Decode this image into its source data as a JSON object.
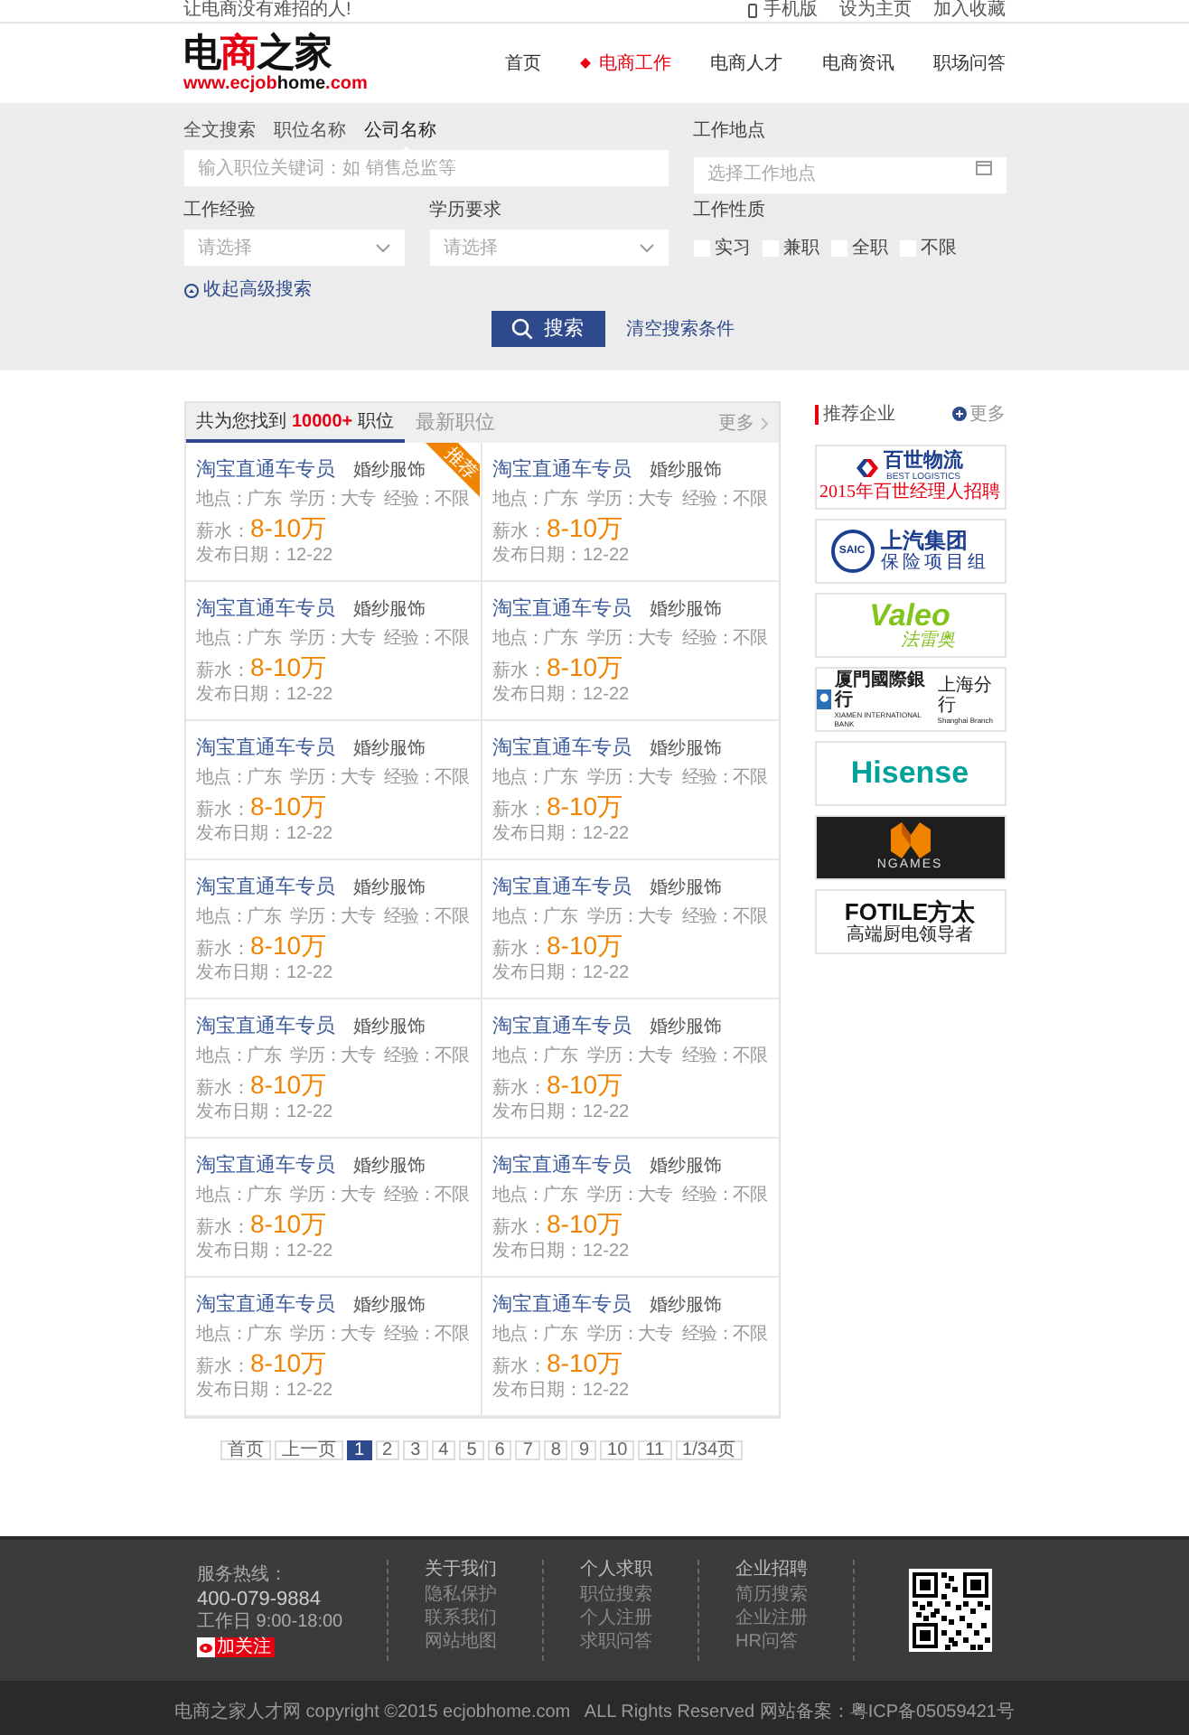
{
  "top_bar": {
    "slogan": "让电商没有难招的人!",
    "links": [
      "手机版",
      "设为主页",
      "加入收藏"
    ]
  },
  "logo": {
    "title_parts": [
      {
        "text": "电",
        "color": "#111111"
      },
      {
        "text": "商",
        "color": "#e60012"
      },
      {
        "text": "之家",
        "color": "#111111"
      }
    ],
    "url_parts": [
      {
        "text": "www.ecjob",
        "color": "#e60012"
      },
      {
        "text": "home",
        "color": "#111111"
      },
      {
        "text": ".com",
        "color": "#e60012"
      }
    ]
  },
  "nav": [
    {
      "label": "首页",
      "selected": false
    },
    {
      "label": "电商工作",
      "selected": true
    },
    {
      "label": "电商人才",
      "selected": false
    },
    {
      "label": "电商资讯",
      "selected": false
    },
    {
      "label": "职场问答",
      "selected": false
    }
  ],
  "search": {
    "tabs": [
      {
        "label": "全文搜索",
        "selected": false
      },
      {
        "label": "职位名称",
        "selected": false
      },
      {
        "label": "公司名称",
        "selected": true
      }
    ],
    "keyword_placeholder": "输入职位关键词：如 销售总监等",
    "location_label": "工作地点",
    "location_placeholder": "选择工作地点",
    "experience_label": "工作经验",
    "experience_placeholder": "请选择",
    "education_label": "学历要求",
    "education_placeholder": "请选择",
    "type_label": "工作性质",
    "types": [
      {
        "label": "实习",
        "checked": false
      },
      {
        "label": "兼职",
        "checked": false
      },
      {
        "label": "全职",
        "checked": false
      },
      {
        "label": "不限",
        "checked": false
      }
    ],
    "collapse_link": "收起高级搜索",
    "search_button": "搜索",
    "clear_link": "清空搜索条件"
  },
  "list_tabs": [
    {
      "label": "共为您找到**10000+**职位",
      "selected": true
    },
    {
      "label": "最新职位",
      "selected": false
    }
  ],
  "more_link": "更多",
  "jobs": [
    {
      "title": "淘宝直通车专员",
      "company": "婚纱服饰",
      "location": "地点：广东",
      "education": "学历：大专",
      "experience": "经验：不限",
      "salary_label": "薪水：",
      "salary": "8-10万",
      "date": "发布日期：12-22",
      "featured": true,
      "badge": "推荐"
    },
    {
      "title": "淘宝直通车专员",
      "company": "婚纱服饰",
      "location": "地点：广东",
      "education": "学历：大专",
      "experience": "经验：不限",
      "salary_label": "薪水：",
      "salary": "8-10万",
      "date": "发布日期：12-22",
      "featured": false
    },
    {
      "title": "淘宝直通车专员",
      "company": "婚纱服饰",
      "location": "地点：广东",
      "education": "学历：大专",
      "experience": "经验：不限",
      "salary_label": "薪水：",
      "salary": "8-10万",
      "date": "发布日期：12-22",
      "featured": false
    },
    {
      "title": "淘宝直通车专员",
      "company": "婚纱服饰",
      "location": "地点：广东",
      "education": "学历：大专",
      "experience": "经验：不限",
      "salary_label": "薪水：",
      "salary": "8-10万",
      "date": "发布日期：12-22",
      "featured": false
    },
    {
      "title": "淘宝直通车专员",
      "company": "婚纱服饰",
      "location": "地点：广东",
      "education": "学历：大专",
      "experience": "经验：不限",
      "salary_label": "薪水：",
      "salary": "8-10万",
      "date": "发布日期：12-22",
      "featured": false
    },
    {
      "title": "淘宝直通车专员",
      "company": "婚纱服饰",
      "location": "地点：广东",
      "education": "学历：大专",
      "experience": "经验：不限",
      "salary_label": "薪水：",
      "salary": "8-10万",
      "date": "发布日期：12-22",
      "featured": false
    },
    {
      "title": "淘宝直通车专员",
      "company": "婚纱服饰",
      "location": "地点：广东",
      "education": "学历：大专",
      "experience": "经验：不限",
      "salary_label": "薪水：",
      "salary": "8-10万",
      "date": "发布日期：12-22",
      "featured": false
    },
    {
      "title": "淘宝直通车专员",
      "company": "婚纱服饰",
      "location": "地点：广东",
      "education": "学历：大专",
      "experience": "经验：不限",
      "salary_label": "薪水：",
      "salary": "8-10万",
      "date": "发布日期：12-22",
      "featured": false
    },
    {
      "title": "淘宝直通车专员",
      "company": "婚纱服饰",
      "location": "地点：广东",
      "education": "学历：大专",
      "experience": "经验：不限",
      "salary_label": "薪水：",
      "salary": "8-10万",
      "date": "发布日期：12-22",
      "featured": false
    },
    {
      "title": "淘宝直通车专员",
      "company": "婚纱服饰",
      "location": "地点：广东",
      "education": "学历：大专",
      "experience": "经验：不限",
      "salary_label": "薪水：",
      "salary": "8-10万",
      "date": "发布日期：12-22",
      "featured": false
    },
    {
      "title": "淘宝直通车专员",
      "company": "婚纱服饰",
      "location": "地点：广东",
      "education": "学历：大专",
      "experience": "经验：不限",
      "salary_label": "薪水：",
      "salary": "8-10万",
      "date": "发布日期：12-22",
      "featured": false
    },
    {
      "title": "淘宝直通车专员",
      "company": "婚纱服饰",
      "location": "地点：广东",
      "education": "学历：大专",
      "experience": "经验：不限",
      "salary_label": "薪水：",
      "salary": "8-10万",
      "date": "发布日期：12-22",
      "featured": false
    },
    {
      "title": "淘宝直通车专员",
      "company": "婚纱服饰",
      "location": "地点：广东",
      "education": "学历：大专",
      "experience": "经验：不限",
      "salary_label": "薪水：",
      "salary": "8-10万",
      "date": "发布日期：12-22",
      "featured": false
    },
    {
      "title": "淘宝直通车专员",
      "company": "婚纱服饰",
      "location": "地点：广东",
      "education": "学历：大专",
      "experience": "经验：不限",
      "salary_label": "薪水：",
      "salary": "8-10万",
      "date": "发布日期：12-22",
      "featured": false
    }
  ],
  "pagination": {
    "first": "首页",
    "prev": "上一页",
    "pages": [
      {
        "label": "1",
        "selected": true
      },
      {
        "label": "2",
        "selected": false
      },
      {
        "label": "3",
        "selected": false
      },
      {
        "label": "4",
        "selected": false
      },
      {
        "label": "5",
        "selected": false
      },
      {
        "label": "6",
        "selected": false
      },
      {
        "label": "7",
        "selected": false
      },
      {
        "label": "8",
        "selected": false
      },
      {
        "label": "9",
        "selected": false
      },
      {
        "label": "10",
        "selected": false
      },
      {
        "label": "11",
        "selected": false
      }
    ],
    "total": "1/34页"
  },
  "sidebar": {
    "title": "推荐企业",
    "more": "更多",
    "companies": [
      {
        "kind": "best",
        "texts": [
          "百世物流",
          "BEST LOGISTICS",
          "2015年百世经理人招聘"
        ]
      },
      {
        "kind": "saic",
        "texts": [
          "SAIC",
          "上汽集团",
          "保险项目组"
        ]
      },
      {
        "kind": "valeo",
        "texts": [
          "Valeo",
          "法雷奥"
        ]
      },
      {
        "kind": "bank",
        "texts": [
          "厦門國際銀行",
          "XIAMEN INTERNATIONAL BANK",
          "上海分行",
          "Shanghai Branch"
        ]
      },
      {
        "kind": "hisense",
        "texts": [
          "Hisense"
        ]
      },
      {
        "kind": "ngames",
        "texts": [
          "NGAMES"
        ]
      },
      {
        "kind": "fotile",
        "texts": [
          "FOTILE方太",
          "高端厨电领导者"
        ]
      }
    ]
  },
  "footer": {
    "hotline_label": "服务热线：",
    "hotline": "400-079-9884",
    "hours": "工作日 9:00-18:00",
    "follow_button": "加关注",
    "columns": [
      {
        "title": "关于我们",
        "links": [
          "隐私保护",
          "联系我们",
          "网站地图"
        ]
      },
      {
        "title": "个人求职",
        "links": [
          "职位搜索",
          "个人注册",
          "求职问答"
        ]
      },
      {
        "title": "企业招聘",
        "links": [
          "简历搜索",
          "企业注册",
          "HR问答"
        ]
      }
    ],
    "copyright": "电商之家人才网 copyright ©2015 ecjobhome.com   ALL Rights Reserved 网站备案：粤ICP备05059421号"
  }
}
